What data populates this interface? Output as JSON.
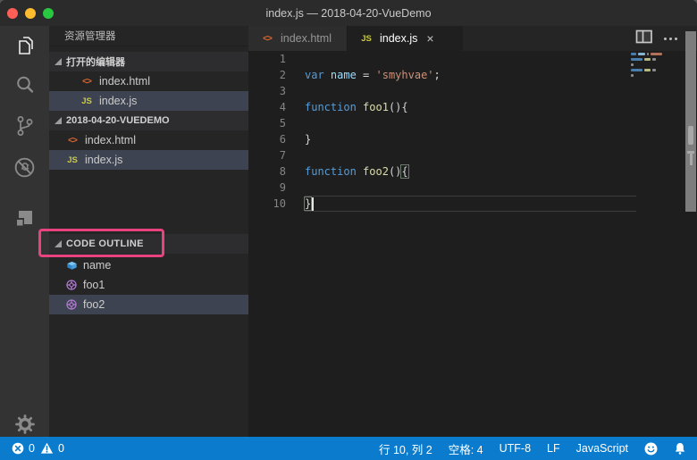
{
  "window": {
    "title": "index.js — 2018-04-20-VueDemo"
  },
  "activity_bar": {
    "items": [
      "explorer",
      "search",
      "source-control",
      "debug",
      "extensions"
    ],
    "settings": "settings"
  },
  "sidebar": {
    "title": "资源管理器",
    "open_editors": {
      "label": "打开的编辑器",
      "items": [
        {
          "label": "index.html"
        },
        {
          "label": "index.js"
        }
      ]
    },
    "folder": {
      "label": "2018-04-20-VUEDEMO",
      "items": [
        {
          "label": "index.html"
        },
        {
          "label": "index.js"
        }
      ]
    },
    "outline": {
      "label": "CODE OUTLINE",
      "items": [
        {
          "label": "name",
          "kind": "variable"
        },
        {
          "label": "foo1",
          "kind": "method"
        },
        {
          "label": "foo2",
          "kind": "method"
        }
      ]
    }
  },
  "icons": {
    "html": "<>",
    "js": "JS",
    "tab_close": "×"
  },
  "tabs": [
    {
      "label": "index.html",
      "active": false
    },
    {
      "label": "index.js",
      "active": true
    }
  ],
  "editor": {
    "lines": [
      {
        "num": "1",
        "tokens": []
      },
      {
        "num": "2",
        "tokens": [
          {
            "text": "var ",
            "type": "keyword"
          },
          {
            "text": "name",
            "type": "variable"
          },
          {
            "text": " = ",
            "type": "operator"
          },
          {
            "text": "'smyhvae'",
            "type": "string"
          },
          {
            "text": ";",
            "type": "punctuation"
          }
        ]
      },
      {
        "num": "3",
        "tokens": []
      },
      {
        "num": "4",
        "tokens": [
          {
            "text": "function ",
            "type": "keyword"
          },
          {
            "text": "foo1",
            "type": "function"
          },
          {
            "text": "(){",
            "type": "punctuation"
          }
        ]
      },
      {
        "num": "5",
        "tokens": []
      },
      {
        "num": "6",
        "tokens": [
          {
            "text": "}",
            "type": "punctuation"
          }
        ]
      },
      {
        "num": "7",
        "tokens": []
      },
      {
        "num": "8",
        "tokens": [
          {
            "text": "function ",
            "type": "keyword"
          },
          {
            "text": "foo2",
            "type": "function"
          },
          {
            "text": "()",
            "type": "punctuation"
          },
          {
            "text": "{",
            "type": "punctuation",
            "bracket_match": true
          }
        ]
      },
      {
        "num": "9",
        "tokens": []
      },
      {
        "num": "10",
        "tokens": [
          {
            "text": "}",
            "type": "punctuation",
            "bracket_match": true
          }
        ]
      }
    ],
    "cursor_line": 10
  },
  "status_bar": {
    "errors": "0",
    "warnings": "0",
    "cursor": "行 10, 列 2",
    "indent": "空格: 4",
    "encoding": "UTF-8",
    "eol": "LF",
    "language": "JavaScript"
  },
  "colors": {
    "status_bar_bg": "#0b7ccd",
    "annotation_box": "#e9437f",
    "keyword": "#569cd6",
    "variable": "#9cdcfe",
    "string": "#ce9178",
    "function_name": "#dcdcaa",
    "js_icon": "#cbcb41",
    "html_icon": "#e0662e",
    "selected_row_bg": "#3d4350"
  }
}
